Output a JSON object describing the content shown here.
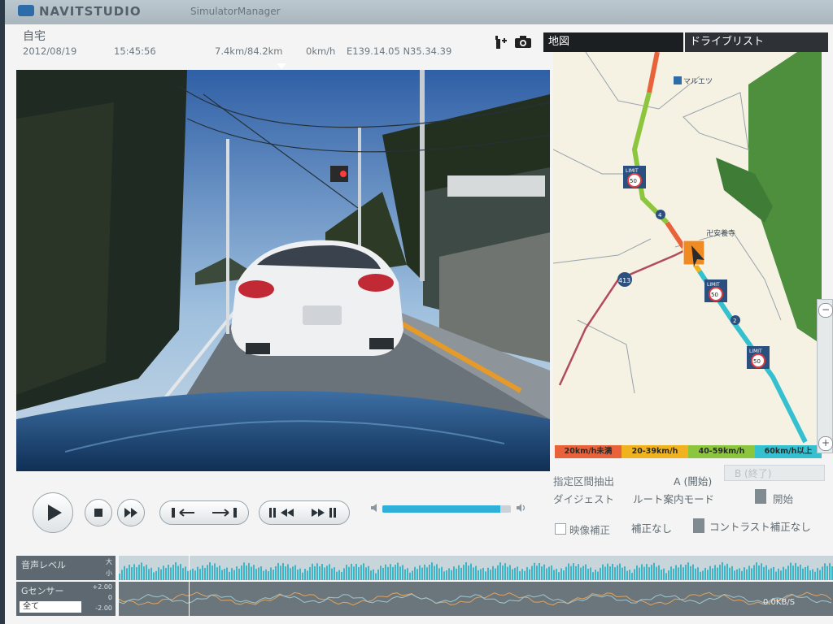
{
  "window": {
    "brand": "NAVITSTUDIO",
    "subtitle": "SimulatorManager"
  },
  "info": {
    "place": "自宅",
    "date": "2012/08/19",
    "time": "15:45:56",
    "distance": "7.4km/84.2km",
    "speed": "0km/h",
    "coordinates": "E139.14.05 N35.34.39"
  },
  "tabs": [
    {
      "label": "地図"
    },
    {
      "label": "ドライブリスト"
    }
  ],
  "map": {
    "labels": {
      "shop": "マルエツ",
      "temple": "卍安養寺",
      "route": "413",
      "route2": "2",
      "route4": "4",
      "limit_sign": "LIMIT",
      "limit_value": "50"
    },
    "speed_legend": [
      {
        "label": "20km/h未満",
        "color": "#e8633a"
      },
      {
        "label": "20-39km/h",
        "color": "#f0b21e"
      },
      {
        "label": "40-59km/h",
        "color": "#8cc63f"
      },
      {
        "label": "60km/h以上",
        "color": "#35c0cf"
      }
    ]
  },
  "playback": {
    "volume": 0.92
  },
  "settings": {
    "section_label": "指定区間抽出",
    "section_start": "A (開始)",
    "section_end": "B (終了)",
    "digest_label": "ダイジェスト",
    "digest_value": "ルート案内モード",
    "digest_start": "開始",
    "video_correction_label": "映像補正",
    "correction_value": "補正なし",
    "contrast_value": "コントラスト補正なし"
  },
  "tracks": {
    "audio_label": "音声レベル",
    "audio_scale_high": "大",
    "audio_scale_low": "小",
    "g_label": "Gセンサー",
    "g_scale_top": "+2.00",
    "g_scale_mid": "0",
    "g_scale_bottom": "-2.00",
    "g_filter": "全て",
    "speed_readout": "0.0KB/S"
  },
  "colors": {
    "tab_active": "#1c1f22",
    "accent": "#2fb0d8",
    "route_fast": "#35c0cf",
    "route_slow": "#e8633a"
  }
}
